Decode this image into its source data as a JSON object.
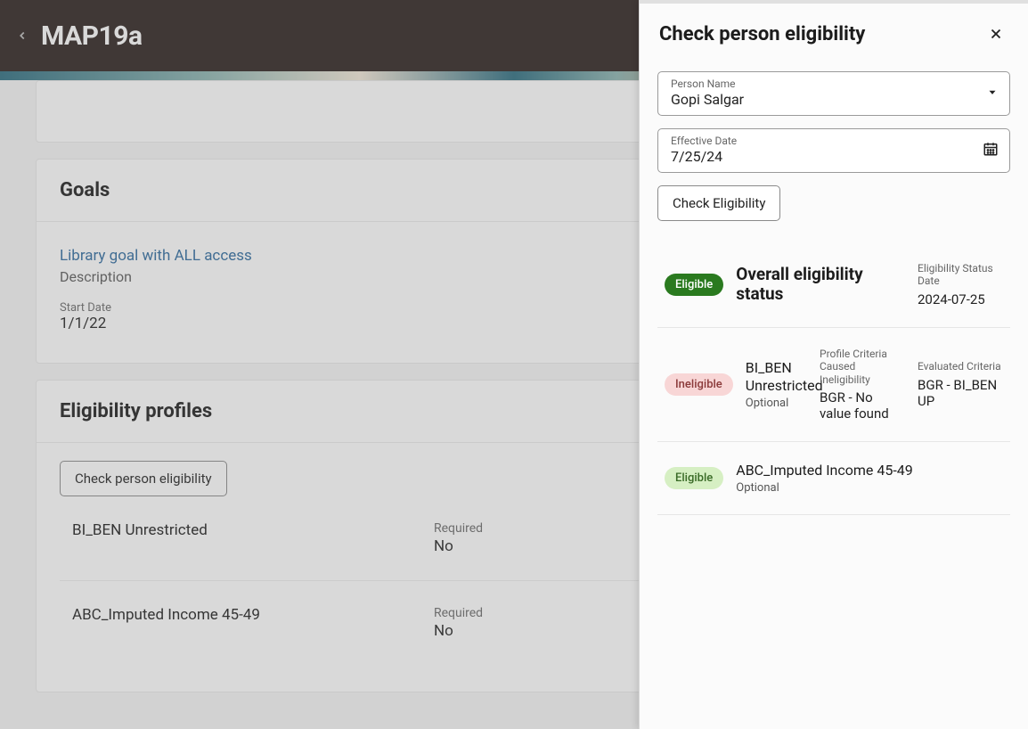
{
  "header": {
    "title": "MAP19a"
  },
  "goals": {
    "section_title": "Goals",
    "goal_link": "Library goal with ALL access",
    "goal_desc": "Description",
    "start_date_label": "Start Date",
    "start_date_value": "1/1/22"
  },
  "profiles": {
    "section_title": "Eligibility profiles",
    "check_button": "Check person eligibility",
    "required_label": "Required",
    "rows": [
      {
        "name": "BI_BEN Unrestricted",
        "required": "No"
      },
      {
        "name": "ABC_Imputed Income 45-49",
        "required": "No"
      }
    ]
  },
  "panel": {
    "title": "Check person eligibility",
    "person_label": "Person Name",
    "person_value": "Gopi Salgar",
    "date_label": "Effective Date",
    "date_value": "7/25/24",
    "check_button": "Check Eligibility",
    "overall": {
      "badge": "Eligible",
      "title": "Overall eligibility status",
      "date_label": "Eligibility Status Date",
      "date_value": "2024-07-25"
    },
    "results": [
      {
        "badge": "Ineligible",
        "badge_class": "ineligible",
        "name": "BI_BEN Unrestricted",
        "sub": "Optional",
        "col1_label": "Profile Criteria Caused Ineligibility",
        "col1_value": "BGR - No value found",
        "col2_label": "Evaluated Criteria",
        "col2_value": "BGR - BI_BEN UP"
      },
      {
        "badge": "Eligible",
        "badge_class": "eligible-light",
        "name": "ABC_Imputed Income 45-49",
        "sub": "Optional",
        "col1_label": "",
        "col1_value": "",
        "col2_label": "",
        "col2_value": ""
      }
    ]
  }
}
